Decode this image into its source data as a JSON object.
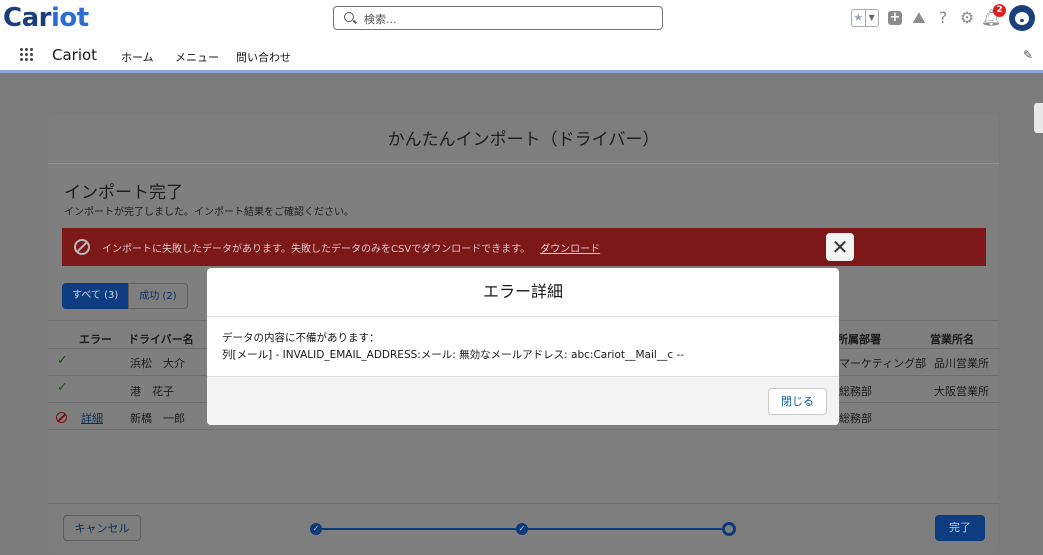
{
  "header": {
    "logo_text_a": "Car",
    "logo_text_b": "iot",
    "search_placeholder": "検索...",
    "notification_count": "2",
    "icons": [
      "star-icon",
      "chevron-down-icon",
      "add-icon",
      "trailhead-icon",
      "help-icon",
      "gear-icon",
      "bell-icon",
      "avatar"
    ]
  },
  "nav": {
    "app_name": "Cariot",
    "items": [
      "ホーム",
      "メニュー",
      "問い合わせ"
    ]
  },
  "import_modal": {
    "title": "かんたんインポート（ドライバー）",
    "heading": "インポート完了",
    "subtitle": "インポートが完了しました。インポート結果をご確認ください。",
    "error_banner": {
      "message": "インポートに失敗したデータがあります。失敗したデータのみをCSVでダウンロードできます。",
      "link": "ダウンロード",
      "close_symbol": "✕"
    },
    "filters": {
      "all": "すべて (3)",
      "success": "成功 (2)"
    },
    "columns": {
      "error": "エラー",
      "driver": "ドライバー名",
      "department": "所属部署",
      "office": "営業所名"
    },
    "rows": [
      {
        "status": "success",
        "detail": "",
        "driver": "浜松　大介",
        "department": "マーケティング部",
        "office": "品川営業所"
      },
      {
        "status": "success",
        "detail": "",
        "driver": "港　花子",
        "department": "総務部",
        "office": "大阪営業所"
      },
      {
        "status": "error",
        "detail": "詳細",
        "driver": "新橋　一郎",
        "department": "総務部",
        "office": ""
      }
    ],
    "cancel_label": "キャンセル",
    "done_label": "完了",
    "progress": {
      "total_steps": 3,
      "completed_steps": 2,
      "check_symbol": "✓"
    }
  },
  "error_dialog": {
    "title": "エラー詳細",
    "line1": "データの内容に不備があります：",
    "line2": "列[メール] - INVALID_EMAIL_ADDRESS:メール: 無効なメールアドレス: abc:Cariot__Mail__c --",
    "close_label": "閉じる"
  },
  "colors": {
    "brand_dark": "#1b3f7a",
    "brand_blue": "#2d6ed4",
    "error_banner": "#7d1818",
    "primary_button": "#0d3d80",
    "link": "#0b5cab"
  }
}
